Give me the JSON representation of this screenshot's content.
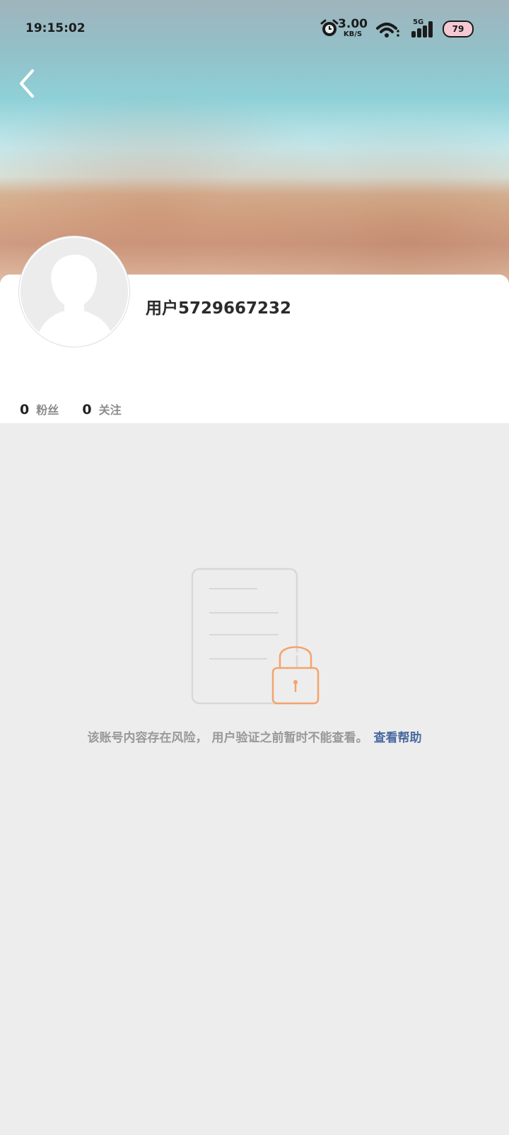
{
  "status_bar": {
    "time": "19:15:02",
    "net_speed_value": "3.00",
    "net_speed_unit": "KB/S",
    "network_type": "5G",
    "battery": "79",
    "icons": [
      "alarm-icon",
      "wifi-icon",
      "signal-icon",
      "battery-icon"
    ]
  },
  "header": {
    "back_icon": "back-icon"
  },
  "profile": {
    "username": "用户5729667232",
    "avatar_icon": "default-avatar-icon",
    "stats": [
      {
        "count": "0",
        "label": "粉丝"
      },
      {
        "count": "0",
        "label": "关注"
      }
    ]
  },
  "notice": {
    "message": "该账号内容存在风险， 用户验证之前暂时不能查看。",
    "help_link": "查看帮助",
    "illustration_icon": "locked-document-icon",
    "help_link_color": "#4a6aa0",
    "lock_color": "#f4a36e"
  }
}
